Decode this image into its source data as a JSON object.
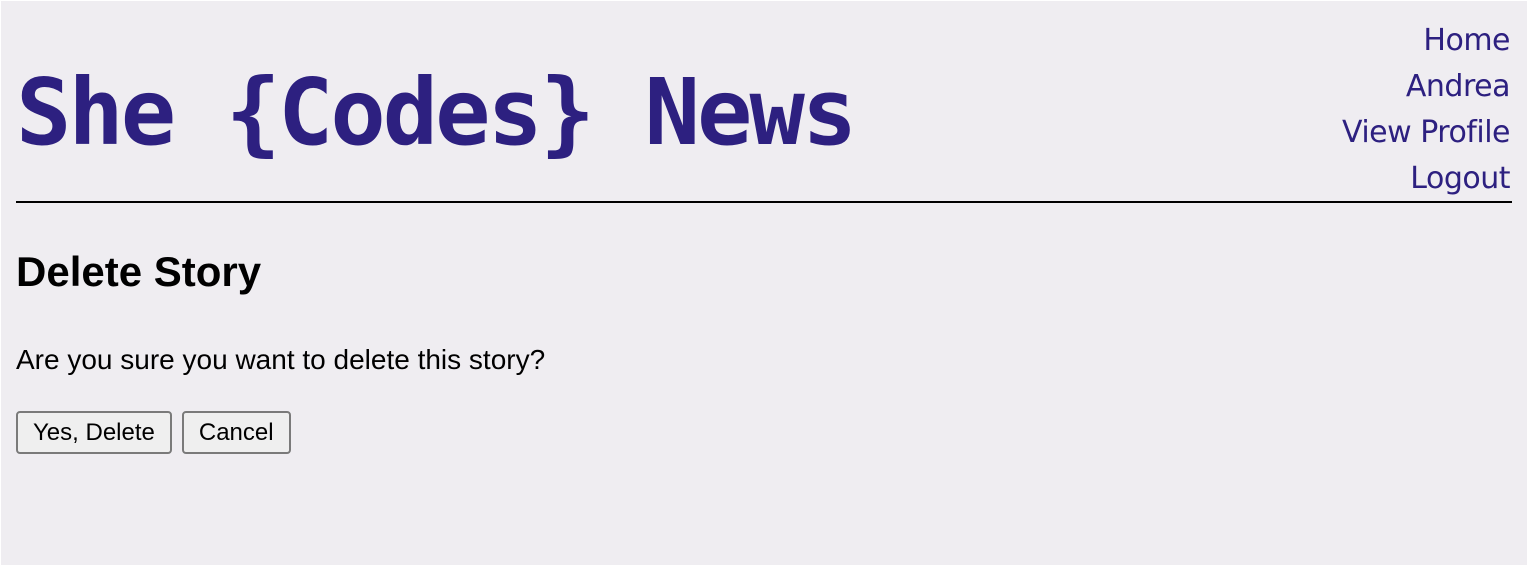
{
  "header": {
    "site_title": "She {Codes} News",
    "nav": [
      {
        "label": "Home"
      },
      {
        "label": "Andrea"
      },
      {
        "label": "View Profile"
      },
      {
        "label": "Logout"
      }
    ]
  },
  "main": {
    "heading": "Delete Story",
    "confirm_text": "Are you sure you want to delete this story?",
    "confirm_button": "Yes, Delete",
    "cancel_button": "Cancel"
  },
  "colors": {
    "background": "#efedf1",
    "brand": "#2d2080",
    "divider": "#000000"
  }
}
